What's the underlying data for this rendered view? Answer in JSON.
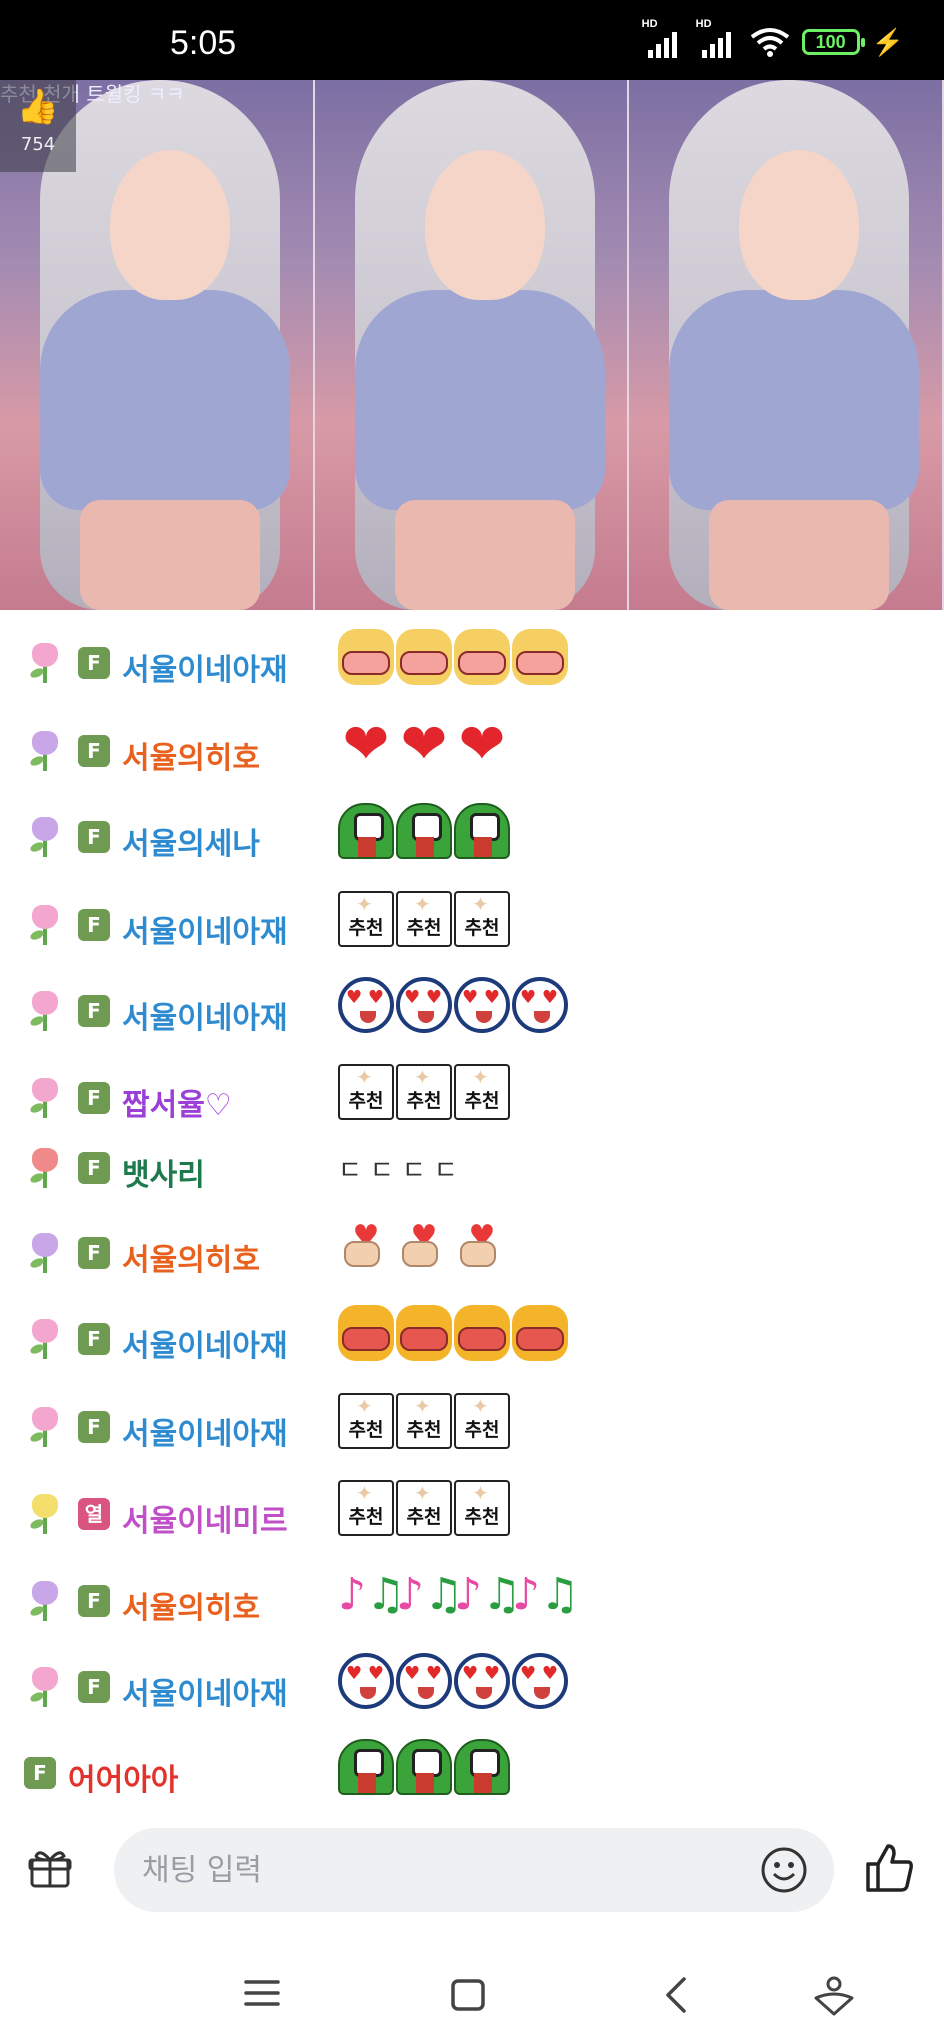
{
  "status_bar": {
    "time": "5:05",
    "battery": "100",
    "signal_label": "HD"
  },
  "video": {
    "ticker": "추천 천개 트윌킹 ㅋㅋ",
    "like_count": "754"
  },
  "chat": {
    "messages": [
      {
        "flower": "tulip-pink-icon",
        "badge": "F",
        "nick": "서율이네아재",
        "nick_color": "#2f8bd0",
        "content": {
          "type": "emoticon",
          "name": "laughing-mouth-emoticon",
          "count": 4
        }
      },
      {
        "flower": "tulip-purple-icon",
        "badge": "F",
        "nick": "서율의히호",
        "nick_color": "#e8611f",
        "content": {
          "type": "emoticon",
          "name": "red-heart-emoticon",
          "count": 3
        }
      },
      {
        "flower": "tulip-purple-icon",
        "badge": "F",
        "nick": "서율의세나",
        "nick_color": "#2f8bd0",
        "content": {
          "type": "emoticon",
          "name": "green-frog-emoticon",
          "count": 3
        }
      },
      {
        "flower": "tulip-pink-icon",
        "badge": "F",
        "nick": "서율이네아재",
        "nick_color": "#2f8bd0",
        "content": {
          "type": "emoticon",
          "name": "chuchun-emoticon",
          "count": 3
        }
      },
      {
        "flower": "tulip-pink-icon",
        "badge": "F",
        "nick": "서율이네아재",
        "nick_color": "#2f8bd0",
        "content": {
          "type": "emoticon",
          "name": "heart-eyes-face-emoticon",
          "count": 4
        }
      },
      {
        "flower": "tulip-pink-icon",
        "badge": "F",
        "nick": "짭서율♡",
        "nick_color": "#9c3fd6",
        "content": {
          "type": "emoticon",
          "name": "chuchun-emoticon",
          "count": 3
        }
      },
      {
        "flower": "tulip-red-icon",
        "badge": "F",
        "nick": "뱃사리",
        "nick_color": "#1c7a4d",
        "content": {
          "type": "text",
          "text": "ㄷㄷㄷㄷ"
        }
      },
      {
        "flower": "tulip-purple-icon",
        "badge": "F",
        "nick": "서율의히호",
        "nick_color": "#e8611f",
        "content": {
          "type": "emoticon",
          "name": "finger-heart-emoticon",
          "count": 3
        }
      },
      {
        "flower": "tulip-pink-icon",
        "badge": "F",
        "nick": "서율이네아재",
        "nick_color": "#2f8bd0",
        "content": {
          "type": "emoticon",
          "name": "big-mouth-emoticon",
          "count": 4
        }
      },
      {
        "flower": "tulip-pink-icon",
        "badge": "F",
        "nick": "서율이네아재",
        "nick_color": "#2f8bd0",
        "content": {
          "type": "emoticon",
          "name": "chuchun-emoticon",
          "count": 3
        }
      },
      {
        "flower": "tulip-yellow-icon",
        "badge": "열",
        "badge_color": "#d9547f",
        "nick": "서율이네미르",
        "nick_color": "#c04fc8",
        "content": {
          "type": "emoticon",
          "name": "chuchun-emoticon",
          "count": 3
        }
      },
      {
        "flower": "tulip-purple-icon",
        "badge": "F",
        "nick": "서율의히호",
        "nick_color": "#e8611f",
        "content": {
          "type": "emoticon",
          "name": "music-note-emoticon",
          "count": 4
        }
      },
      {
        "flower": "tulip-pink-icon",
        "badge": "F",
        "nick": "서율이네아재",
        "nick_color": "#2f8bd0",
        "content": {
          "type": "emoticon",
          "name": "heart-eyes-face-emoticon",
          "count": 4
        }
      },
      {
        "flower": "",
        "badge": "F",
        "nick": "어어아아",
        "nick_color": "#e3322b",
        "content": {
          "type": "emoticon",
          "name": "green-frog-emoticon",
          "count": 3
        }
      }
    ],
    "chuchun_text": "추천"
  },
  "input_bar": {
    "placeholder": "채팅 입력"
  },
  "colors": {
    "badge_green": "#6e9a52",
    "input_bg": "#eff0f2"
  }
}
